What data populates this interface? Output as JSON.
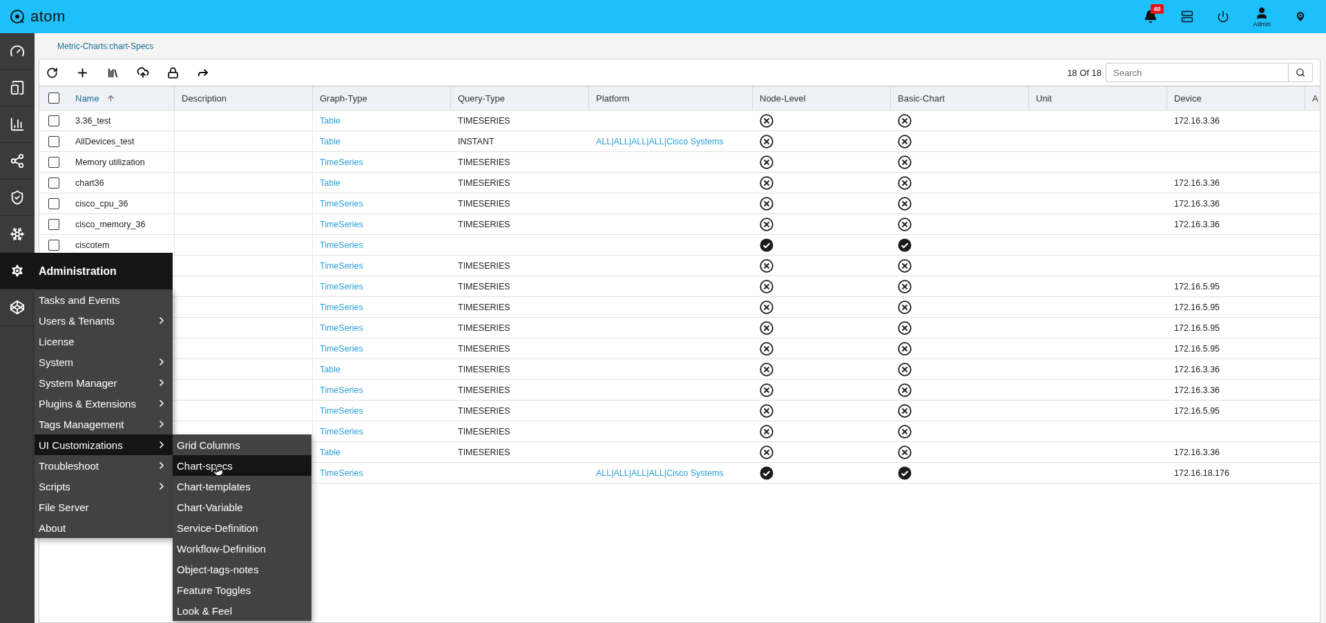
{
  "top_bar": {
    "logo": "atom",
    "notification_count": "40",
    "user_label": "Admin"
  },
  "breadcrumb": "Metric-Charts:chart-Specs",
  "toolbar": {
    "record_count": "18 Of 18",
    "search": {
      "placeholder": "Search"
    }
  },
  "table": {
    "select_all": {
      "checked": false
    },
    "columns": [
      {
        "label": "Name",
        "sorted": true
      },
      {
        "label": "Description",
        "sorted": false
      },
      {
        "label": "Graph-Type",
        "sorted": false
      },
      {
        "label": "Query-Type",
        "sorted": false
      },
      {
        "label": "Platform",
        "sorted": false
      },
      {
        "label": "Node-Level",
        "sorted": false
      },
      {
        "label": "Basic-Chart",
        "sorted": false
      },
      {
        "label": "Unit",
        "sorted": false
      },
      {
        "label": "Device",
        "sorted": false
      },
      {
        "label": "A",
        "sorted": false
      }
    ],
    "rows": [
      {
        "checked": false,
        "name": "3.36_test",
        "graph_type": "Table",
        "query_type": "TIMESERIES",
        "node_level": false,
        "basic_chart": false,
        "device": "172.16.3.36"
      },
      {
        "checked": false,
        "name": "AllDevices_test",
        "graph_type": "Table",
        "query_type": "INSTANT",
        "platform": "ALL|ALL|ALL|ALL|Cisco Systems",
        "node_level": false,
        "basic_chart": false
      },
      {
        "checked": false,
        "name": "Memory utilization",
        "graph_type": "TimeSeries",
        "query_type": "TIMESERIES",
        "node_level": false,
        "basic_chart": false
      },
      {
        "checked": false,
        "name": "chart36",
        "graph_type": "Table",
        "query_type": "TIMESERIES",
        "node_level": false,
        "basic_chart": false,
        "device": "172.16.3.36"
      },
      {
        "checked": false,
        "name": "cisco_cpu_36",
        "graph_type": "TimeSeries",
        "query_type": "TIMESERIES",
        "node_level": false,
        "basic_chart": false,
        "device": "172.16.3.36"
      },
      {
        "checked": false,
        "name": "cisco_memory_36",
        "graph_type": "TimeSeries",
        "query_type": "TIMESERIES",
        "node_level": false,
        "basic_chart": false,
        "device": "172.16.3.36"
      },
      {
        "checked": false,
        "name": "ciscotem",
        "graph_type": "TimeSeries",
        "node_level": true,
        "basic_chart": true
      },
      {
        "graph_type": "TimeSeries",
        "query_type": "TIMESERIES",
        "node_level": false,
        "basic_chart": false
      },
      {
        "graph_type": "TimeSeries",
        "query_type": "TIMESERIES",
        "node_level": false,
        "basic_chart": false,
        "device": "172.16.5.95"
      },
      {
        "graph_type": "TimeSeries",
        "query_type": "TIMESERIES",
        "node_level": false,
        "basic_chart": false,
        "device": "172.16.5.95"
      },
      {
        "graph_type": "TimeSeries",
        "query_type": "TIMESERIES",
        "node_level": false,
        "basic_chart": false,
        "device": "172.16.5.95"
      },
      {
        "graph_type": "TimeSeries",
        "query_type": "TIMESERIES",
        "node_level": false,
        "basic_chart": false,
        "device": "172.16.5.95"
      },
      {
        "graph_type": "Table",
        "query_type": "TIMESERIES",
        "node_level": false,
        "basic_chart": false,
        "device": "172.16.3.36"
      },
      {
        "graph_type": "TimeSeries",
        "query_type": "TIMESERIES",
        "node_level": false,
        "basic_chart": false,
        "device": "172.16.3.36"
      },
      {
        "graph_type": "TimeSeries",
        "query_type": "TIMESERIES",
        "node_level": false,
        "basic_chart": false,
        "device": "172.16.5.95"
      },
      {
        "graph_type": "TimeSeries",
        "query_type": "TIMESERIES",
        "node_level": false,
        "basic_chart": false
      },
      {
        "graph_type": "Table",
        "query_type": "TIMESERIES",
        "node_level": false,
        "basic_chart": false,
        "device": "172.16.3.36"
      },
      {
        "graph_type": "TimeSeries",
        "platform": "ALL|ALL|ALL|ALL|Cisco Systems",
        "node_level": true,
        "basic_chart": true,
        "device": "172.16.18.176"
      }
    ]
  },
  "admin_menu": {
    "title": "Administration",
    "items": [
      {
        "label": "Tasks and Events",
        "has_submenu": false,
        "selected": false
      },
      {
        "label": "Users & Tenants",
        "has_submenu": true,
        "selected": false
      },
      {
        "label": "License",
        "has_submenu": false,
        "selected": false
      },
      {
        "label": "System",
        "has_submenu": true,
        "selected": false
      },
      {
        "label": "System Manager",
        "has_submenu": true,
        "selected": false
      },
      {
        "label": "Plugins & Extensions",
        "has_submenu": true,
        "selected": false
      },
      {
        "label": "Tags Management",
        "has_submenu": true,
        "selected": false
      },
      {
        "label": "UI Customizations",
        "has_submenu": true,
        "selected": true
      },
      {
        "label": "Troubleshoot",
        "has_submenu": true,
        "selected": false
      },
      {
        "label": "Scripts",
        "has_submenu": true,
        "selected": false
      },
      {
        "label": "File Server",
        "has_submenu": false,
        "selected": false
      },
      {
        "label": "About",
        "has_submenu": false,
        "selected": false
      }
    ],
    "submenu": [
      {
        "label": "Grid Columns",
        "selected": false
      },
      {
        "label": "Chart-specs",
        "selected": true
      },
      {
        "label": "Chart-templates",
        "selected": false
      },
      {
        "label": "Chart-Variable",
        "selected": false
      },
      {
        "label": "Service-Definition",
        "selected": false
      },
      {
        "label": "Workflow-Definition",
        "selected": false
      },
      {
        "label": "Object-tags-notes",
        "selected": false
      },
      {
        "label": "Feature Toggles",
        "selected": false
      },
      {
        "label": "Look & Feel",
        "selected": false
      }
    ]
  }
}
